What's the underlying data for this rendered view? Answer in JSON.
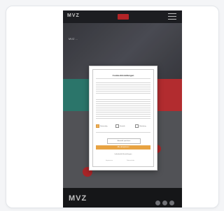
{
  "app": {
    "name": "MVZ"
  },
  "header": {
    "logo_text": "MVZ"
  },
  "hero": {
    "text": "MVZ ..."
  },
  "cookie_dialog": {
    "title": "Cookie-Einstellungen",
    "options": [
      {
        "label": "Notwendig",
        "checked": true
      },
      {
        "label": "Statistik",
        "checked": false
      },
      {
        "label": "Marketing",
        "checked": false
      }
    ],
    "buttons": {
      "save": "Auswahl speichern",
      "accept_all": "Alle akzeptieren",
      "settings": "Individuelle Einstellungen"
    },
    "footer_links": [
      "Impressum",
      "Datenschutz"
    ]
  },
  "footer": {
    "logo_text": "MVZ"
  },
  "colors": {
    "accent_green": "#2f7f74",
    "accent_red": "#c23033",
    "accept_button": "#e8a342",
    "dark_background": "#17181b"
  },
  "icons": [
    "menu-icon",
    "social-icon"
  ]
}
